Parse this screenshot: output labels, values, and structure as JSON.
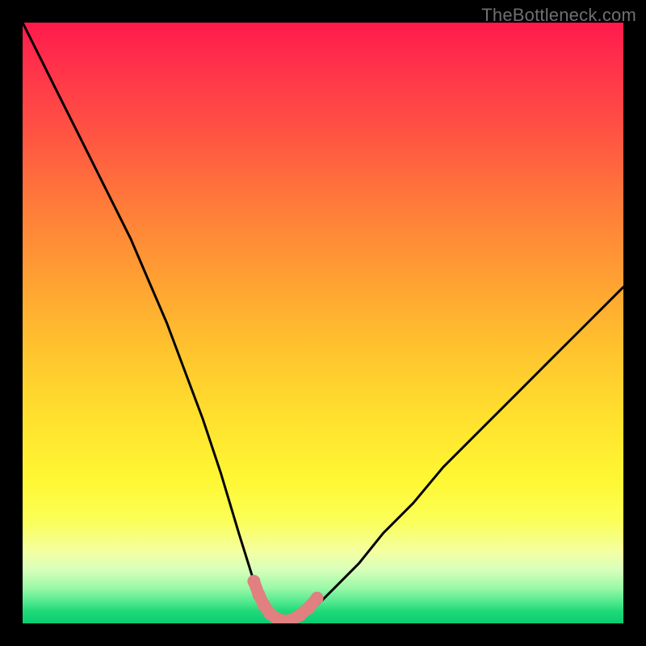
{
  "watermark": "TheBottleneck.com",
  "chart_data": {
    "type": "line",
    "title": "",
    "xlabel": "",
    "ylabel": "",
    "xlim": [
      0,
      100
    ],
    "ylim": [
      0,
      100
    ],
    "grid": false,
    "legend": false,
    "series": [
      {
        "name": "bottleneck-curve",
        "x": [
          0,
          3,
          6,
          9,
          12,
          15,
          18,
          21,
          24,
          27,
          30,
          33,
          36,
          38.5,
          40,
          41.5,
          43,
          44.5,
          46.5,
          49,
          52,
          56,
          60,
          65,
          70,
          76,
          82,
          88,
          94,
          100
        ],
        "y": [
          100,
          94,
          88,
          82,
          76,
          70,
          64,
          57,
          50,
          42,
          34,
          25,
          15,
          7,
          3,
          1,
          0,
          0,
          1,
          3,
          6,
          10,
          15,
          20,
          26,
          32,
          38,
          44,
          50,
          56
        ]
      },
      {
        "name": "highlight-dots",
        "x": [
          38.5,
          39.3,
          40.2,
          41.2,
          42.3,
          43.5,
          44.8,
          46.2,
          47.6,
          49.0
        ],
        "y": [
          7.0,
          4.8,
          3.0,
          1.6,
          0.8,
          0.4,
          0.6,
          1.4,
          2.6,
          4.2
        ]
      }
    ],
    "gradient_stops": [
      {
        "pos": 0.0,
        "color": "#ff1a4b"
      },
      {
        "pos": 0.18,
        "color": "#ff5243"
      },
      {
        "pos": 0.42,
        "color": "#ff9e33"
      },
      {
        "pos": 0.66,
        "color": "#ffe12e"
      },
      {
        "pos": 0.83,
        "color": "#fbff58"
      },
      {
        "pos": 0.94,
        "color": "#9df9a8"
      },
      {
        "pos": 1.0,
        "color": "#0acc74"
      }
    ]
  }
}
